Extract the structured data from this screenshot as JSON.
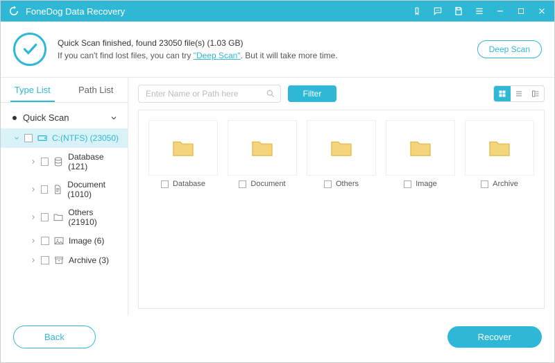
{
  "titlebar": {
    "title": "FoneDog Data Recovery"
  },
  "status": {
    "line1_prefix": "Quick Scan finished, found ",
    "file_count": "23050",
    "line1_mid": " file(s) (",
    "size": "1.03 GB",
    "line1_suffix": ")",
    "line2_prefix": "If you can't find lost files, you can try ",
    "deep_scan_link": "\"Deep Scan\"",
    "line2_suffix": ". But it will take more time.",
    "deep_scan_btn": "Deep Scan"
  },
  "sidebar": {
    "tabs": {
      "type_list": "Type List",
      "path_list": "Path List"
    },
    "quick_scan": "Quick Scan",
    "drive": "C:(NTFS) (23050)",
    "items": [
      {
        "label": "Database (121)"
      },
      {
        "label": "Document (1010)"
      },
      {
        "label": "Others (21910)"
      },
      {
        "label": "Image (6)"
      },
      {
        "label": "Archive (3)"
      }
    ]
  },
  "toolbar": {
    "search_placeholder": "Enter Name or Path here",
    "filter": "Filter"
  },
  "grid": {
    "folders": [
      {
        "label": "Database"
      },
      {
        "label": "Document"
      },
      {
        "label": "Others"
      },
      {
        "label": "Image"
      },
      {
        "label": "Archive"
      }
    ]
  },
  "footer": {
    "back": "Back",
    "recover": "Recover"
  }
}
